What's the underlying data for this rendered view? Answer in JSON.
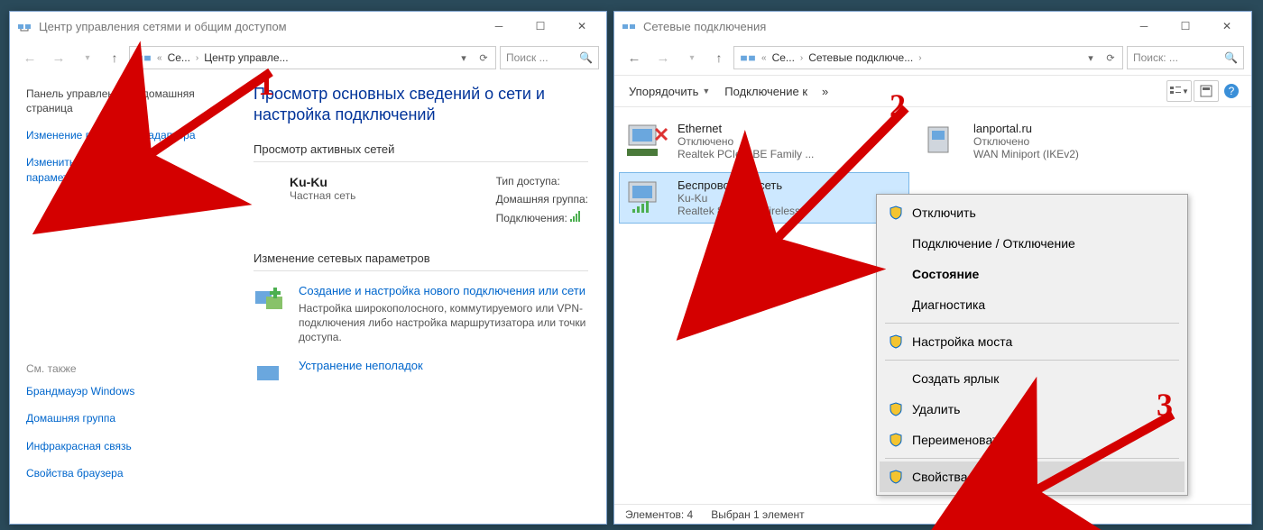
{
  "annotations": {
    "num1": "1",
    "num2": "2",
    "num3": "3"
  },
  "left": {
    "title": "Центр управления сетями и общим доступом",
    "breadcrumb": {
      "root": "Се...",
      "current": "Центр управле..."
    },
    "search_placeholder": "Поиск ...",
    "side_head": "Панель управления — домашняя страница",
    "links": {
      "adapter": "Изменение параметров адаптера",
      "sharing": "Изменить дополнительные параметры общего доступа"
    },
    "see_also_label": "См. также",
    "see_also": {
      "firewall": "Брандмауэр Windows",
      "homegroup": "Домашняя группа",
      "infrared": "Инфракрасная связь",
      "browser": "Свойства браузера"
    },
    "main_title": "Просмотр основных сведений о сети и настройка подключений",
    "active_nets_label": "Просмотр активных сетей",
    "net": {
      "name": "Ku-Ku",
      "type": "Частная сеть"
    },
    "props": {
      "access_label": "Тип доступа:",
      "homegroup_label": "Домашняя группа:",
      "connections_label": "Подключения:"
    },
    "change_section": "Изменение сетевых параметров",
    "item1": {
      "link": "Создание и настройка нового подключения или сети",
      "desc": "Настройка широкополосного, коммутируемого или VPN-подключения либо настройка маршрутизатора или точки доступа."
    },
    "item2": {
      "link": "Устранение неполадок"
    }
  },
  "right": {
    "title": "Сетевые подключения",
    "breadcrumb": {
      "root": "Се...",
      "current": "Сетевые подключе..."
    },
    "search_placeholder": "Поиск: ...",
    "toolbar": {
      "organize": "Упорядочить",
      "connect": "Подключение к",
      "more": "»"
    },
    "adapters": {
      "ethernet": {
        "name": "Ethernet",
        "status": "Отключено",
        "dev": "Realtek PCIe GBE Family ..."
      },
      "lanportal": {
        "name": "lanportal.ru",
        "status": "Отключено",
        "dev": "WAN Miniport (IKEv2)"
      },
      "wifi": {
        "name": "Беспроводная сеть",
        "status": "Ku-Ku",
        "dev": "Realtek 8821AE Wireless"
      }
    },
    "context": {
      "disable": "Отключить",
      "connect_disc": "Подключение / Отключение",
      "state": "Состояние",
      "diag": "Диагностика",
      "bridge": "Настройка моста",
      "shortcut": "Создать ярлык",
      "delete": "Удалить",
      "rename": "Переименовать",
      "props": "Свойства"
    },
    "status": {
      "count": "Элементов: 4",
      "selected": "Выбран 1 элемент"
    }
  }
}
